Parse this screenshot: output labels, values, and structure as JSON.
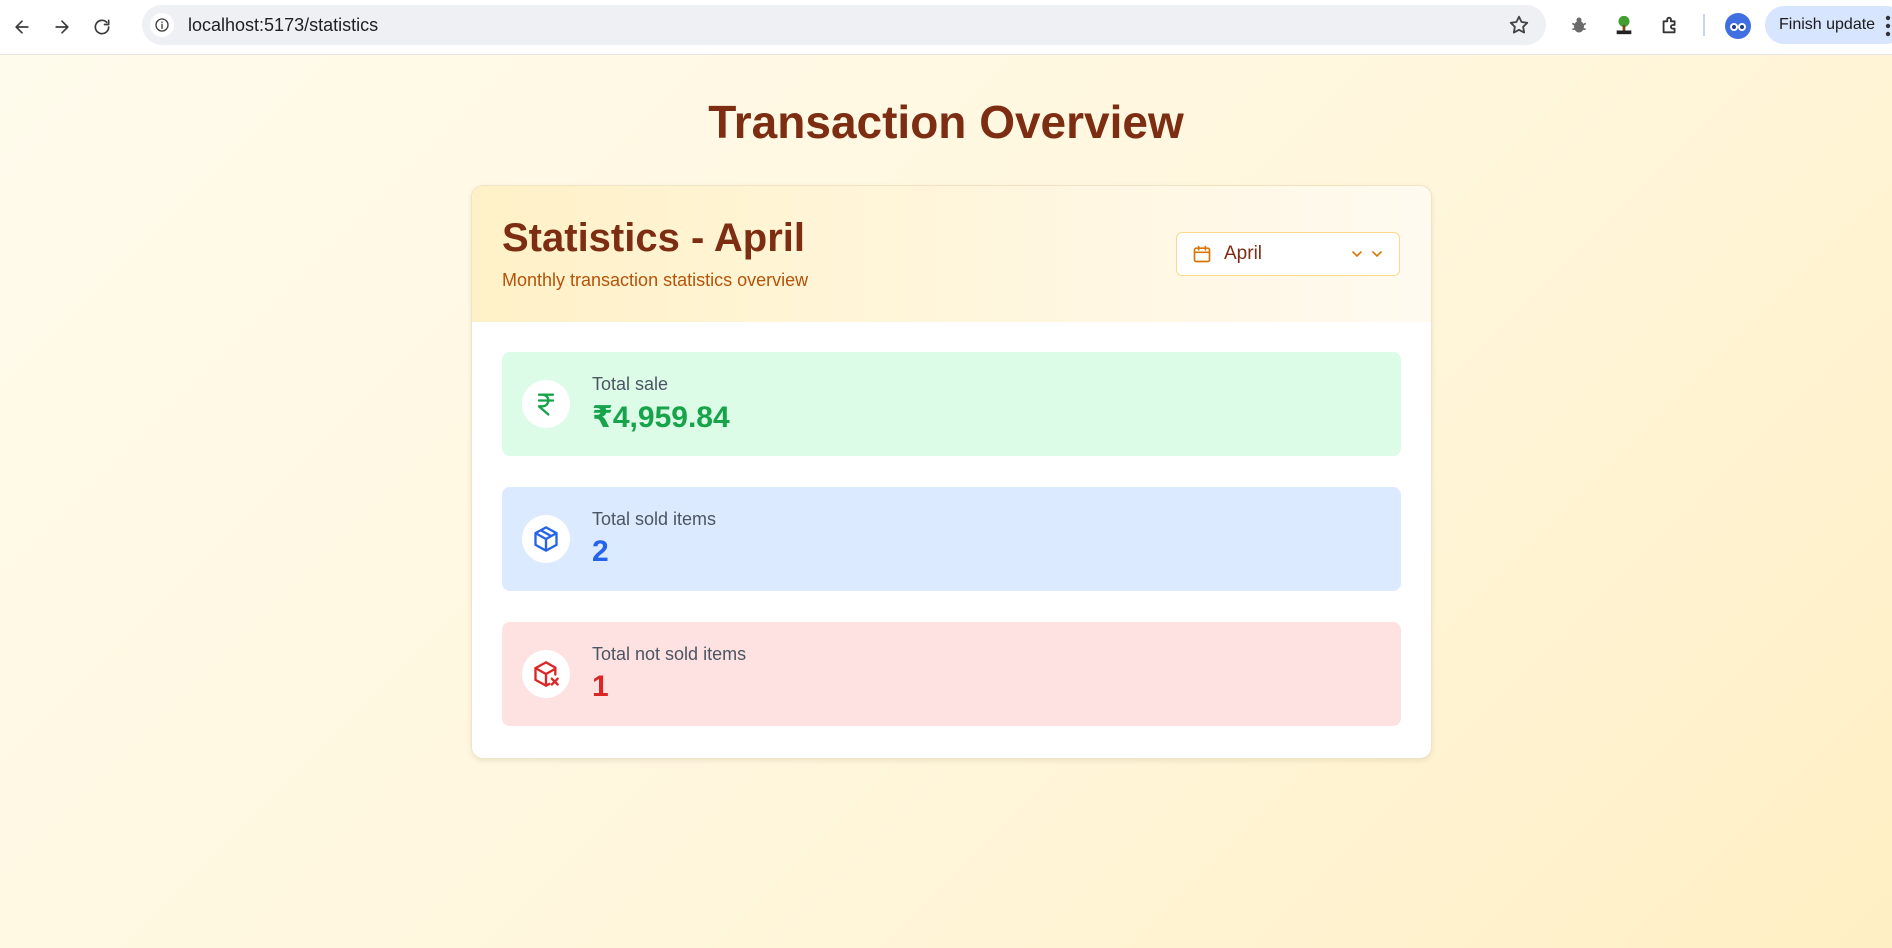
{
  "browser": {
    "url": "localhost:5173/statistics",
    "finish_update_label": "Finish update"
  },
  "page": {
    "title": "Transaction Overview"
  },
  "card": {
    "title": "Statistics - April",
    "subtitle": "Monthly transaction statistics overview",
    "month_select": {
      "selected": "April"
    }
  },
  "stats": [
    {
      "label": "Total sale",
      "value": "₹4,959.84",
      "icon": "rupee-icon",
      "color": "#16a34a"
    },
    {
      "label": "Total sold items",
      "value": "2",
      "icon": "package-icon",
      "color": "#2563eb"
    },
    {
      "label": "Total not sold items",
      "value": "1",
      "icon": "package-x-icon",
      "color": "#dc2626"
    }
  ],
  "colors": {
    "brand_dark": "#7c2d12",
    "accent_amber": "#b45309",
    "green_bg": "#dcfce7",
    "blue_bg": "#dbeafe",
    "red_bg": "#fee2e2"
  }
}
